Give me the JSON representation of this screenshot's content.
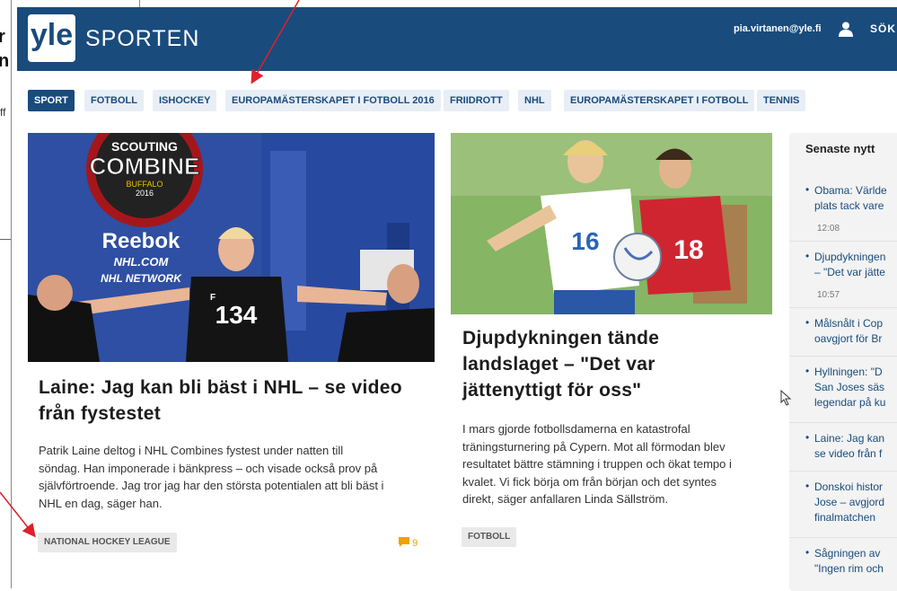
{
  "background_document": {
    "words": [
      "r",
      "n"
    ],
    "fragment": "ff"
  },
  "header": {
    "logo_text": "yle",
    "section_title": "SPORTEN",
    "user_email": "pia.virtanen@yle.fi",
    "user_icon": "user-icon",
    "search_label": "SÖK"
  },
  "nav": {
    "tags": [
      {
        "label": "SPORT",
        "active": true
      },
      {
        "label": "FOTBOLL",
        "active": false
      },
      {
        "label": "ISHOCKEY",
        "active": false
      },
      {
        "label": "EUROPAMÄSTERSKAPET I FOTBOLL 2016",
        "active": false
      },
      {
        "label": "FRIIDROTT",
        "active": false
      },
      {
        "label": "NHL",
        "active": false
      },
      {
        "label": "EUROPAMÄSTERSKAPET I FOTBOLL",
        "active": false
      },
      {
        "label": "TENNIS",
        "active": false
      }
    ]
  },
  "article1": {
    "image_text": {
      "scouting": "SCOUTING",
      "combine": "COMBINE",
      "buffalo": "BUFFALO",
      "year": "2016",
      "reebok": "Reebok",
      "nhl_com": "NHL.COM",
      "nhl_network": "NHL NETWORK",
      "jersey": "134",
      "jersey_letter": "F"
    },
    "title_line1": "Laine: Jag kan bli bäst i NHL – se video",
    "title_line2": "från fystestet",
    "body": [
      "Patrik Laine deltog i NHL Combines fystest under natten till",
      "söndag. Han imponerade i bänkpress – och visade också prov på",
      "självförtroende. Jag tror jag har den största potentialen att bli bäst i",
      "NHL en dag, säger han."
    ],
    "tag": "NATIONAL HOCKEY LEAGUE",
    "comment_count": "9"
  },
  "article2": {
    "image_text": {
      "number_left": "16",
      "number_right": "18"
    },
    "title": [
      "Djupdykningen tände",
      "landslaget – \"Det var",
      "jättenyttigt för oss\""
    ],
    "body": [
      "I mars gjorde fotbollsdamerna en katastrofal",
      "träningsturnering på Cypern. Mot all förmodan blev",
      "resultatet bättre stämning i truppen och ökat tempo i",
      "kvalet. Vi fick börja om från början och det syntes",
      "direkt, säger anfallaren Linda Sällström."
    ],
    "tag": "FOTBOLL"
  },
  "sidebar": {
    "title": "Senaste nytt",
    "items": [
      {
        "lines": [
          "Obama: Världe",
          "plats tack vare"
        ],
        "time": "12:08"
      },
      {
        "lines": [
          "Djupdykningen",
          "– \"Det var jätte"
        ],
        "time": "10:57"
      },
      {
        "lines": [
          "Målsnålt i Cop",
          "oavgjort för Br"
        ],
        "time": ""
      },
      {
        "lines": [
          "Hyllningen: \"D",
          "San Joses säs",
          "legendar på ku"
        ],
        "time": ""
      },
      {
        "lines": [
          "Laine: Jag kan",
          "se video från f"
        ],
        "time": ""
      },
      {
        "lines": [
          "Donskoi histor",
          "Jose – avgjord",
          "finalmatchen"
        ],
        "time": ""
      },
      {
        "lines": [
          "Sågningen av",
          "\"Ingen rim och"
        ],
        "time": ""
      }
    ]
  },
  "colors": {
    "brand": "#194b7d",
    "annotation_arrow": "#e0202a",
    "comment": "#f0a000"
  }
}
